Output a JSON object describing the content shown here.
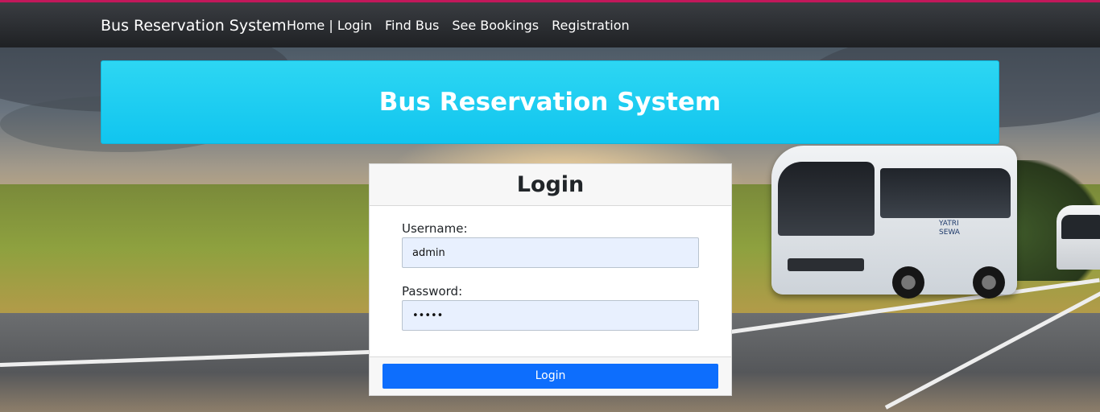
{
  "navbar": {
    "brand": "Bus Reservation System",
    "links": [
      {
        "label": "Home | Login"
      },
      {
        "label": "Find Bus"
      },
      {
        "label": "See Bookings"
      },
      {
        "label": "Registration"
      }
    ]
  },
  "header": {
    "title": "Bus Reservation System"
  },
  "login": {
    "title": "Login",
    "username_label": "Username:",
    "username_value": "admin",
    "password_label": "Password:",
    "password_value": "admin",
    "button_label": "Login"
  },
  "bus_logo": "YATRI SEWA",
  "colors": {
    "top_accent": "#c2185b",
    "banner": "#1fcdf1",
    "primary_button": "#0d6efd",
    "input_autofill": "#e8f0fe"
  }
}
